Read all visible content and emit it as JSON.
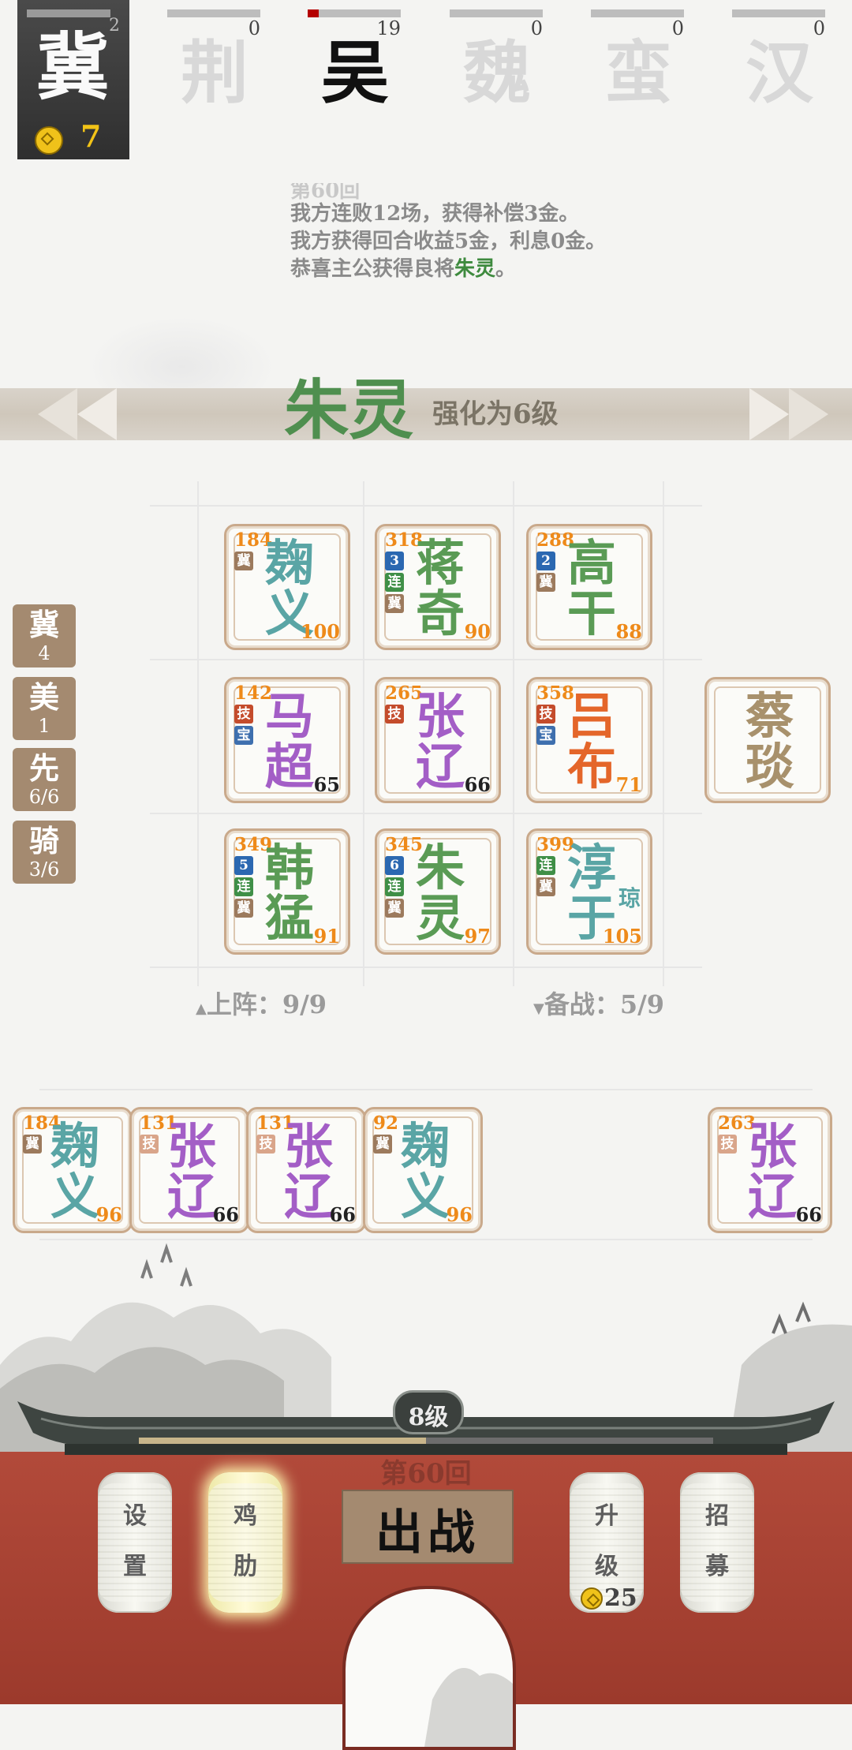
{
  "player": {
    "name": "冀",
    "count": "2",
    "gold": "7"
  },
  "factions": [
    {
      "name": "荆",
      "count": "0",
      "active": false,
      "progress": 0
    },
    {
      "name": "吴",
      "count": "19",
      "active": true,
      "progress": 0.12
    },
    {
      "name": "魏",
      "count": "0",
      "active": false,
      "progress": 0
    },
    {
      "name": "蛮",
      "count": "0",
      "active": false,
      "progress": 0
    },
    {
      "name": "汉",
      "count": "0",
      "active": false,
      "progress": 0
    }
  ],
  "log": {
    "partial_line": "第60回",
    "line1": "我方连败12场，获得补偿3金。",
    "line2": "我方获得回合收益5金，利息0金。",
    "line3_prefix": "恭喜主公获得良将",
    "line3_name": "朱灵",
    "line3_suffix": "。"
  },
  "banner": {
    "general": "朱灵",
    "text": "强化为6级"
  },
  "side_chips": [
    {
      "title": "冀",
      "value": "4"
    },
    {
      "title": "美",
      "value": "1"
    },
    {
      "title": "先",
      "value": "6/6"
    },
    {
      "title": "骑",
      "value": "3/6"
    }
  ],
  "board": {
    "row1": [
      {
        "hp": "184",
        "c1": "麹",
        "c2": "义",
        "atk": "100",
        "tags": [
          "冀"
        ],
        "color": "teal"
      },
      {
        "hp": "318",
        "c1": "蒋",
        "c2": "奇",
        "atk": "90",
        "tags": [
          "3",
          "连",
          "冀"
        ],
        "color": "green"
      },
      {
        "hp": "288",
        "c1": "高",
        "c2": "干",
        "atk": "88",
        "tags": [
          "2",
          "冀"
        ],
        "color": "green"
      }
    ],
    "row2": [
      {
        "hp": "142",
        "c1": "马",
        "c2": "超",
        "atk": "65",
        "tags": [
          "技",
          "宝"
        ],
        "color": "purple"
      },
      {
        "hp": "265",
        "c1": "张",
        "c2": "辽",
        "atk": "66",
        "tags": [
          "技"
        ],
        "color": "purple"
      },
      {
        "hp": "358",
        "c1": "吕",
        "c2": "布",
        "atk": "71",
        "tags": [
          "技",
          "宝"
        ],
        "color": "orange"
      }
    ],
    "row3": [
      {
        "hp": "349",
        "c1": "韩",
        "c2": "猛",
        "atk": "91",
        "tags": [
          "5",
          "连",
          "冀"
        ],
        "color": "green"
      },
      {
        "hp": "345",
        "c1": "朱",
        "c2": "灵",
        "atk": "97",
        "tags": [
          "6",
          "连",
          "冀"
        ],
        "color": "green"
      },
      {
        "hp": "399",
        "c1": "淳",
        "c2": "于",
        "sub": "琼",
        "atk": "105",
        "tags": [
          "连",
          "冀"
        ],
        "color": "teal"
      }
    ],
    "side_card": {
      "c1": "蔡",
      "c2": "琰",
      "color": "brown"
    }
  },
  "counts": {
    "deployed": "上阵：9/9",
    "reserve": "备战：5/9"
  },
  "bench": [
    {
      "hp": "184",
      "c1": "麹",
      "c2": "义",
      "atk": "96",
      "tags": [
        "冀"
      ],
      "color": "teal"
    },
    {
      "hp": "131",
      "c1": "张",
      "c2": "辽",
      "atk": "66",
      "tags": [
        "技"
      ],
      "color": "purple"
    },
    {
      "hp": "131",
      "c1": "张",
      "c2": "辽",
      "atk": "66",
      "tags": [
        "技"
      ],
      "color": "purple"
    },
    {
      "hp": "92",
      "c1": "麹",
      "c2": "义",
      "atk": "96",
      "tags": [
        "冀"
      ],
      "color": "teal"
    },
    {
      "hp": "263",
      "c1": "张",
      "c2": "辽",
      "atk": "66",
      "tags": [
        "技"
      ],
      "color": "purple"
    }
  ],
  "bottom": {
    "level": "8级",
    "round": "第60回",
    "fight": "出战",
    "settings": [
      "设",
      "置"
    ],
    "chicken": [
      "鸡",
      "肋"
    ],
    "upgrade": [
      "升",
      "级"
    ],
    "upgrade_cost": "25",
    "recruit": [
      "招",
      "募"
    ],
    "level_progress": 0.5
  }
}
